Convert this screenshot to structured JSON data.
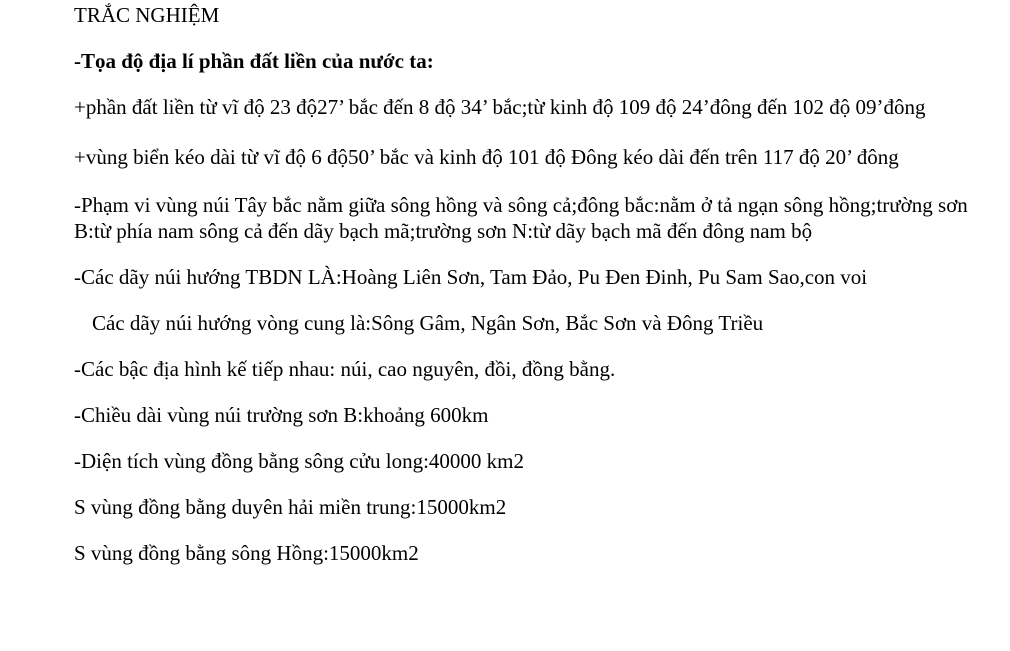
{
  "document": {
    "heading": "TRẮC NGHIỆM",
    "paragraphs": [
      "-Tọa độ địa lí phần đất liền của nước ta:",
      "+phần đất liền từ vĩ độ 23 độ27’ bắc đến 8 độ 34’ bắc;từ kinh độ 109 độ 24’đông đến 102 độ 09’đông",
      "+vùng biển kéo dài từ vĩ độ 6 độ50’ bắc và kinh độ 101 độ Đông kéo dài đến trên 117 độ 20’ đông",
      "-Phạm vi vùng núi Tây bắc nằm giữa sông hồng và sông cả;đông bắc:nằm ở tả ngạn sông hồng;trường sơn B:từ phía nam sông cả đến dãy bạch mã;trường sơn N:từ dãy bạch mã đến đông nam bộ",
      "-Các dãy núi hướng TBDN LÀ:Hoàng Liên Sơn, Tam Đảo, Pu Đen Đinh, Pu Sam Sao,con voi",
      "Các dãy núi hướng vòng cung là:Sông Gâm, Ngân Sơn, Bắc Sơn và Đông Triều",
      "-Các bậc địa hình kế tiếp nhau: núi, cao nguyên, đồi, đồng bằng.",
      "-Chiều dài vùng núi trường sơn B:khoảng 600km",
      "-Diện tích vùng đồng bằng sông cửu long:40000 km2",
      "S vùng đồng bằng duyên hải miền trung:15000km2",
      "S vùng đồng bằng sông Hồng:15000km2"
    ]
  }
}
